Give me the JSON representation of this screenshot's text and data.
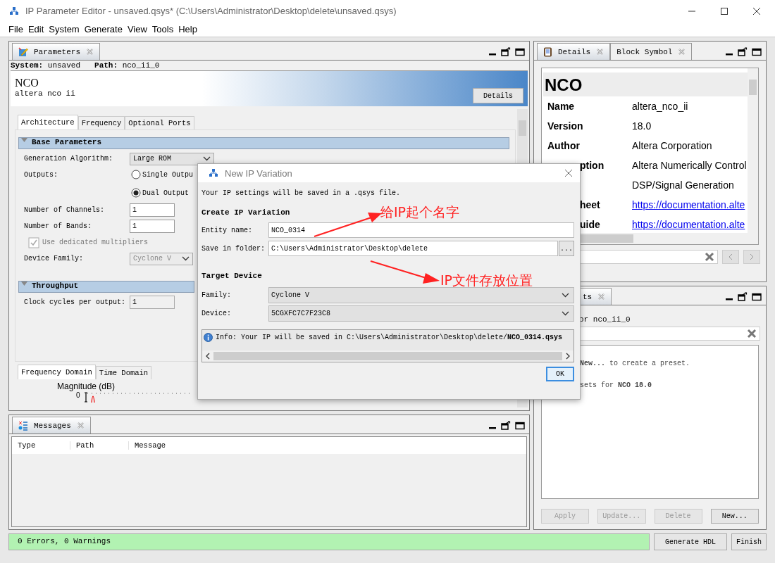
{
  "window": {
    "title": "IP Parameter Editor - unsaved.qsys* (C:\\Users\\Administrator\\Desktop\\delete\\unsaved.qsys)"
  },
  "menu": [
    "File",
    "Edit",
    "System",
    "Generate",
    "View",
    "Tools",
    "Help"
  ],
  "parameters_panel": {
    "tab": "Parameters",
    "info": [
      "**System:** unsaved",
      "**Path:** nco_ii_0"
    ],
    "header": {
      "title": "NCO",
      "subtitle": "altera nco ii",
      "button": "Details"
    },
    "tabs": [
      {
        "label": "Architecture",
        "selected": true
      },
      {
        "label": "Frequency",
        "selected": false
      },
      {
        "label": "Optional Ports",
        "selected": false
      }
    ],
    "sections": [
      {
        "title": "Base Parameters",
        "expanded": true,
        "rows": [
          {
            "kind": "dropdown",
            "label": "Generation Algorithm:",
            "value": "Large ROM",
            "disabled": false
          },
          {
            "kind": "radio",
            "label": "Outputs:",
            "options": [
              {
                "label": "Single Outpu",
                "selected": false
              },
              {
                "label": "Dual Output",
                "selected": true
              }
            ]
          },
          {
            "kind": "number",
            "label": "Number of Channels:",
            "value": "1",
            "disabled": false
          },
          {
            "kind": "number",
            "label": "Number of Bands:",
            "value": "1",
            "disabled": false
          },
          {
            "kind": "checkbox",
            "label": "Use dedicated multipliers",
            "checked": true,
            "disabled": true
          },
          {
            "kind": "dropdown",
            "label": "Device Family:",
            "value": "Cyclone V",
            "disabled": true
          }
        ]
      },
      {
        "title": "Throughput",
        "expanded": true,
        "rows": [
          {
            "kind": "number",
            "label": "Clock cycles per output:",
            "value": "1",
            "disabled": true
          }
        ]
      }
    ],
    "plot_tabs": [
      {
        "label": "Frequency Domain",
        "selected": true
      },
      {
        "label": "Time Domain",
        "selected": false
      }
    ],
    "plot": {
      "title": "Magnitude (dB)",
      "tick": "0"
    }
  },
  "messages_panel": {
    "tab": "Messages",
    "columns": [
      "Type",
      "Path",
      "Message"
    ]
  },
  "details_panel": {
    "tabs": [
      {
        "label": "Details",
        "selected": true
      },
      {
        "label": "Block Symbol",
        "selected": false
      }
    ],
    "heading": "NCO",
    "rows": [
      {
        "kind": "plain",
        "label": "Name",
        "value": "altera_nco_ii",
        "link": false
      },
      {
        "kind": "plain",
        "label": "Version",
        "value": "18.0",
        "link": false
      },
      {
        "kind": "plain",
        "label": "Author",
        "value": "Altera Corporation",
        "link": false
      },
      {
        "kind": "covered",
        "label": "ption",
        "value": "Altera Numerically Control",
        "link": false
      },
      {
        "kind": "covered",
        "value": "DSP/Signal Generation",
        "link": false
      },
      {
        "kind": "covered",
        "label": "heet",
        "value": "https://documentation.alte",
        "link": true
      },
      {
        "kind": "covered",
        "label": "uide",
        "value": "https://documentation.alte",
        "link": true
      }
    ]
  },
  "presets_panel": {
    "tab": "ts",
    "caption": "or nco_ii_0",
    "lines": [
      "**New...** to create a preset.",
      "sets for **NCO 18.0**"
    ],
    "buttons": [
      {
        "label": "Apply",
        "disabled": true
      },
      {
        "label": "Update...",
        "disabled": true
      },
      {
        "label": "Delete",
        "disabled": true
      },
      {
        "label": "New...",
        "disabled": false
      }
    ]
  },
  "status_bar": {
    "text": "0 Errors, 0 Warnings",
    "buttons": [
      "Generate HDL",
      "Finish"
    ]
  },
  "dialog": {
    "title": "New IP Variation",
    "intro": "Your IP settings will be saved in a .qsys file.",
    "create_heading": "Create IP Variation",
    "fields": [
      {
        "label": "Entity name:",
        "value": "NCO_0314"
      },
      {
        "label": "Save in folder:",
        "value": "C:\\Users\\Administrator\\Desktop\\delete",
        "browse": "..."
      }
    ],
    "target_heading": "Target Device",
    "selects": [
      {
        "label": "Family:",
        "value": "Cyclone V"
      },
      {
        "label": "Device:",
        "value": "5CGXFC7C7F23C8"
      }
    ],
    "info": "Info: Your IP will be saved in C:\\Users\\Administrator\\Desktop\\delete/**NCO_0314.qsys**",
    "ok": "OK"
  },
  "annotations": [
    {
      "text": "给IP起个名字"
    },
    {
      "text": "IP文件存放位置"
    }
  ]
}
